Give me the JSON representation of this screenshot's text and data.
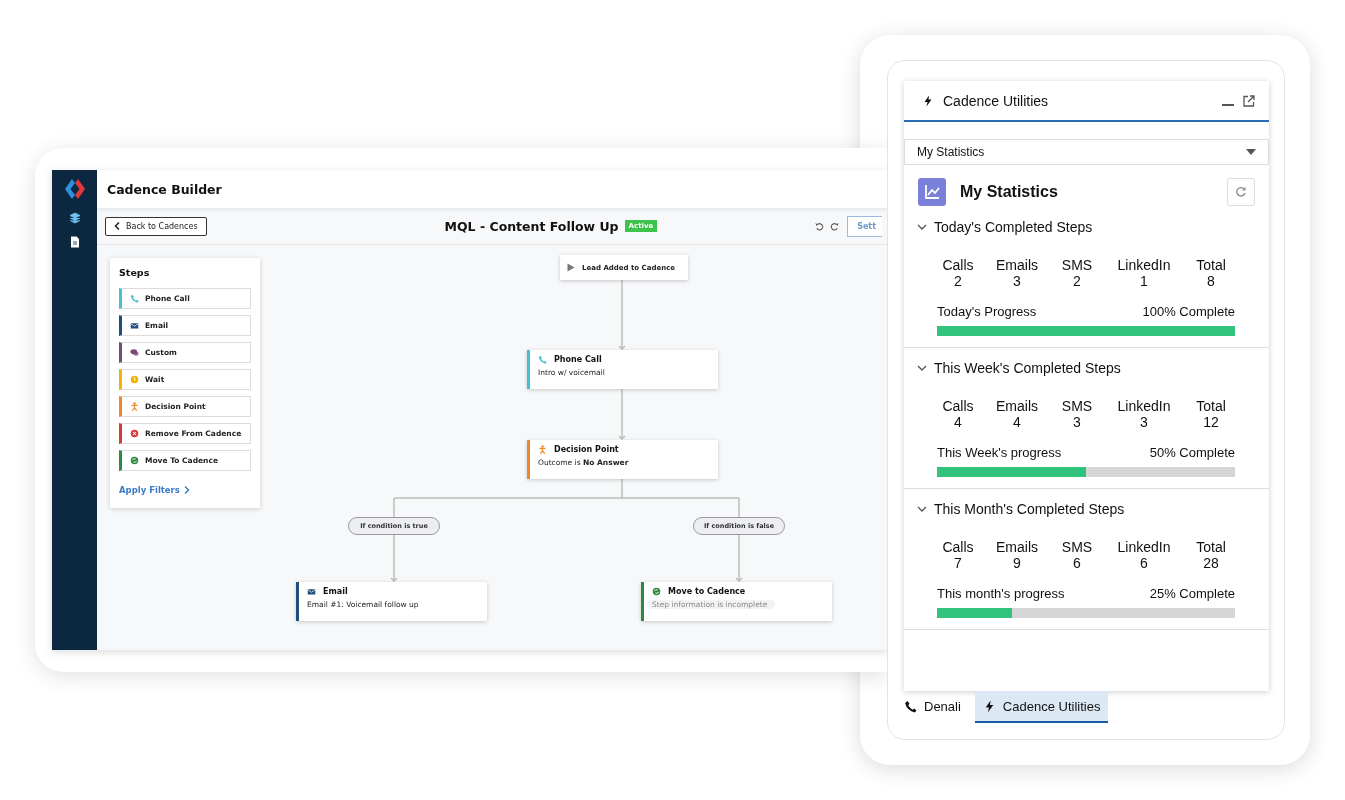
{
  "builder": {
    "nav": [
      {
        "kind": "layers",
        "selected": true
      },
      {
        "kind": "document",
        "selected": false
      }
    ],
    "title": "Cadence Builder",
    "back_button": "Back to Cadences",
    "cadence_name": "MQL - Content Follow Up",
    "status": "Active",
    "settings_button": "Sett",
    "steps_panel": {
      "title": "Steps",
      "items": [
        {
          "kind": "phone",
          "label": "Phone Call",
          "color": "#45bfcf"
        },
        {
          "kind": "email",
          "label": "Email",
          "color": "#1f4e79"
        },
        {
          "kind": "custom",
          "label": "Custom",
          "color": "#7a4a78"
        },
        {
          "kind": "wait",
          "label": "Wait",
          "color": "#f2b300"
        },
        {
          "kind": "decision",
          "label": "Decision Point",
          "color": "#f0862a"
        },
        {
          "kind": "remove",
          "label": "Remove From Cadence",
          "color": "#d63a3d"
        },
        {
          "kind": "move",
          "label": "Move To Cadence",
          "color": "#2e8b3e"
        }
      ],
      "apply_filters": "Apply Filters"
    },
    "trigger": "Lead Added to Cadence",
    "nodes": [
      {
        "kind": "phone",
        "title": "Phone Call",
        "subtitle": "Intro w/ voicemail",
        "color": "#45bfcf",
        "incomplete": false
      },
      {
        "kind": "decision",
        "title": "Decision Point",
        "subtitle": "Outcome is **No Answer**",
        "color": "#f0862a",
        "incomplete": false
      },
      {
        "kind": "email",
        "title": "Email",
        "subtitle": "Email #1: Voicemail follow up",
        "color": "#1f4e79",
        "incomplete": false
      },
      {
        "kind": "move",
        "title": "Move to Cadence",
        "subtitle": "Step information is incomplete",
        "color": "#2e8b3e",
        "incomplete": true
      }
    ],
    "branches": [
      "If condition is true",
      "If condition is false"
    ]
  },
  "utilities": {
    "title": "Cadence Utilities",
    "dropdown": {
      "value": "My Statistics"
    },
    "card_title": "My Statistics",
    "sections": [
      {
        "title": "Today's Completed Steps",
        "expanded": true,
        "stats": [
          {
            "label": "Calls",
            "value": "2"
          },
          {
            "label": "Emails",
            "value": "3"
          },
          {
            "label": "SMS",
            "value": "2"
          },
          {
            "label": "LinkedIn",
            "value": "1"
          },
          {
            "label": "Total",
            "value": "8"
          }
        ],
        "progress_label": "Today's Progress",
        "reading": "100% Complete",
        "level": 1
      },
      {
        "title": "This Week's Completed Steps",
        "expanded": true,
        "stats": [
          {
            "label": "Calls",
            "value": "4"
          },
          {
            "label": "Emails",
            "value": "4"
          },
          {
            "label": "SMS",
            "value": "3"
          },
          {
            "label": "LinkedIn",
            "value": "3"
          },
          {
            "label": "Total",
            "value": "12"
          }
        ],
        "progress_label": "This Week's progress",
        "reading": "50% Complete",
        "level": 0.5
      },
      {
        "title": "This Month's Completed Steps",
        "expanded": true,
        "stats": [
          {
            "label": "Calls",
            "value": "7"
          },
          {
            "label": "Emails",
            "value": "9"
          },
          {
            "label": "SMS",
            "value": "6"
          },
          {
            "label": "LinkedIn",
            "value": "6"
          },
          {
            "label": "Total",
            "value": "28"
          }
        ],
        "progress_label": "This month's progress",
        "reading": "25% Complete",
        "level": 0.25
      }
    ],
    "tabs": [
      {
        "kind": "phone",
        "label": "Denali",
        "selected": false
      },
      {
        "kind": "bolt",
        "label": "Cadence Utilities",
        "selected": true
      }
    ]
  }
}
